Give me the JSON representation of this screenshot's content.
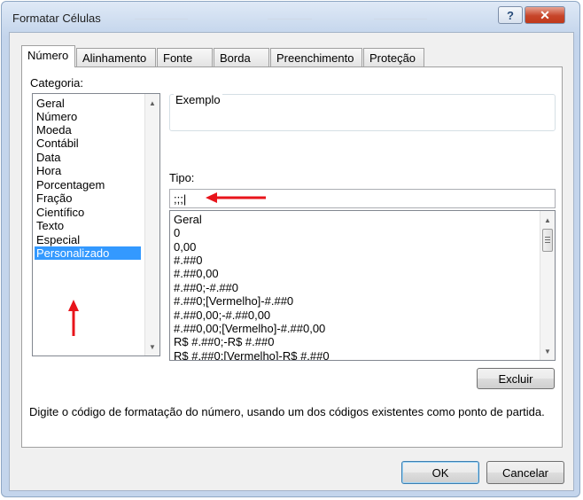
{
  "window": {
    "title": "Formatar Células",
    "help_glyph": "?",
    "close_glyph": "✕"
  },
  "tabs": [
    {
      "label": "Número"
    },
    {
      "label": "Alinhamento"
    },
    {
      "label": "Fonte"
    },
    {
      "label": "Borda"
    },
    {
      "label": "Preenchimento"
    },
    {
      "label": "Proteção"
    }
  ],
  "category": {
    "label": "Categoria:",
    "items": [
      "Geral",
      "Número",
      "Moeda",
      "Contábil",
      "Data",
      "Hora",
      "Porcentagem",
      "Fração",
      "Científico",
      "Texto",
      "Especial",
      "Personalizado"
    ],
    "selected": "Personalizado"
  },
  "example": {
    "label": "Exemplo"
  },
  "type": {
    "label": "Tipo:",
    "value": ";;;|"
  },
  "format_list": [
    "Geral",
    "0",
    "0,00",
    "#.##0",
    "#.##0,00",
    "#.##0;-#.##0",
    "#.##0;[Vermelho]-#.##0",
    "#.##0,00;-#.##0,00",
    "#.##0,00;[Vermelho]-#.##0,00",
    "R$ #.##0;-R$ #.##0",
    "R$ #.##0;[Vermelho]-R$ #.##0"
  ],
  "buttons": {
    "delete": "Excluir",
    "ok": "OK",
    "cancel": "Cancelar"
  },
  "description": "Digite o código de formatação do número, usando um dos códigos existentes como ponto de partida.",
  "colors": {
    "selection": "#3399ff",
    "annotation_arrow": "#e8141b"
  }
}
